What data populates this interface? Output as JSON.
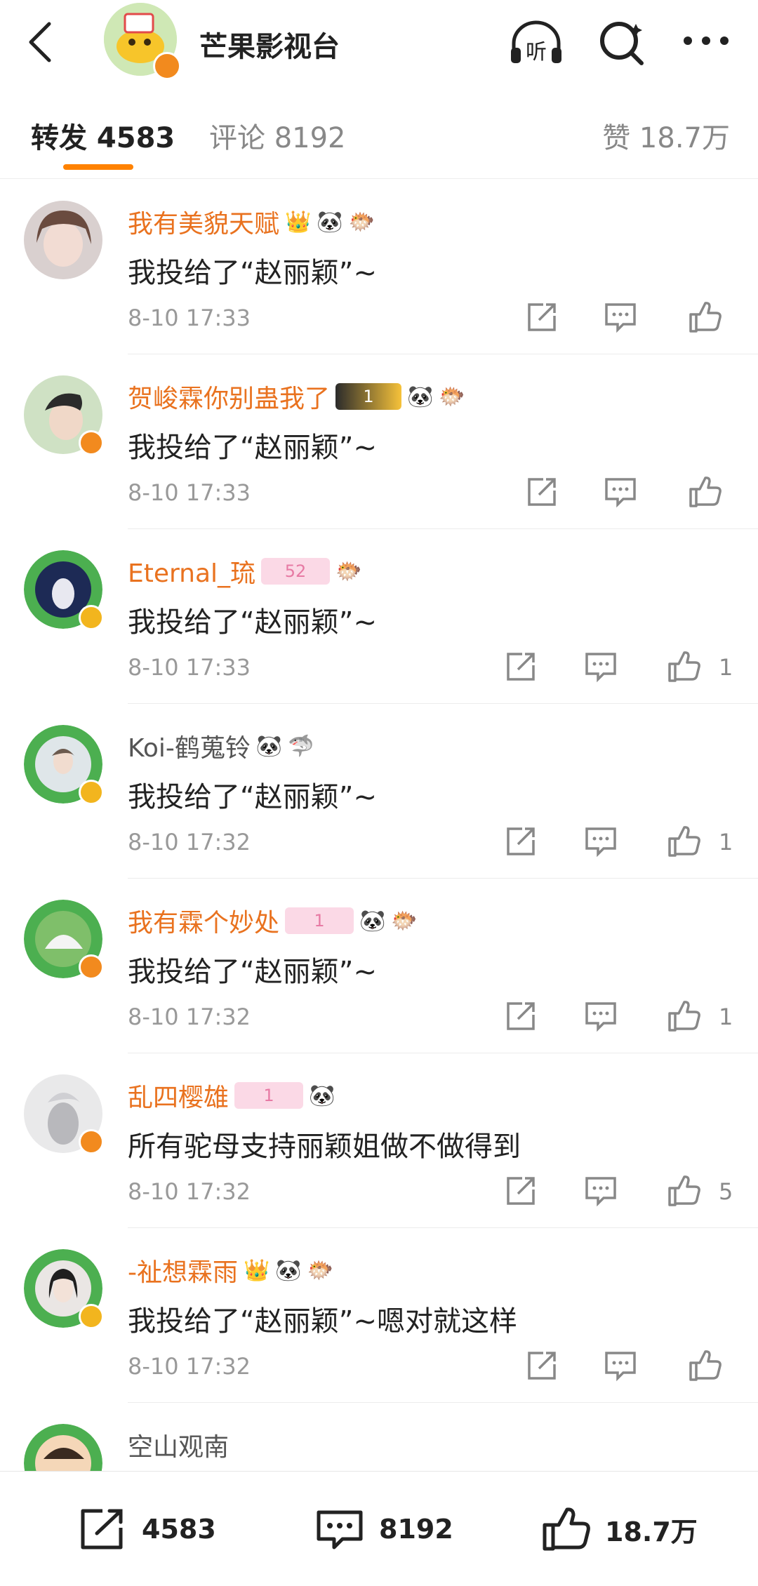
{
  "header": {
    "account_name": "芒果影视台",
    "listen_label": "听"
  },
  "tabs": {
    "reposts": "转发 4583",
    "comments": "评论 8192",
    "likes": "赞 18.7万"
  },
  "comments": [
    {
      "user": "我有美貌天赋",
      "text": "我投给了“赵丽颖”~",
      "time": "8-10 17:33",
      "likes": ""
    },
    {
      "user": "贺峻霖你别蛊我了",
      "text": "我投给了“赵丽颖”~",
      "time": "8-10 17:33",
      "likes": "",
      "level_badge": "1"
    },
    {
      "user": "Eternal_琉",
      "text": "我投给了“赵丽颖”~",
      "time": "8-10 17:33",
      "likes": "1",
      "level_badge": "52"
    },
    {
      "user": "Koi-鹤蒐铃",
      "text": "我投给了“赵丽颖”~",
      "time": "8-10 17:32",
      "likes": "1"
    },
    {
      "user": "我有霖个妙处",
      "text": "我投给了“赵丽颖”~",
      "time": "8-10 17:32",
      "likes": "1",
      "level_badge": "1"
    },
    {
      "user": "乱四樱雄",
      "text": "所有驼母支持丽颖姐做不做得到",
      "time": "8-10 17:32",
      "likes": "5",
      "level_badge": "1"
    },
    {
      "user": "-祉想霖雨",
      "text": "我投给了“赵丽颖”~嗯对就这样",
      "time": "8-10 17:32",
      "likes": ""
    },
    {
      "user": "空山观南",
      "text": "",
      "time": "",
      "likes": ""
    }
  ],
  "bottom_bar": {
    "reposts": "4583",
    "comments": "8192",
    "likes": "18.7万"
  },
  "colors": {
    "accent": "#ff8200",
    "username": "#e9721f",
    "secondary_text": "#999999"
  }
}
